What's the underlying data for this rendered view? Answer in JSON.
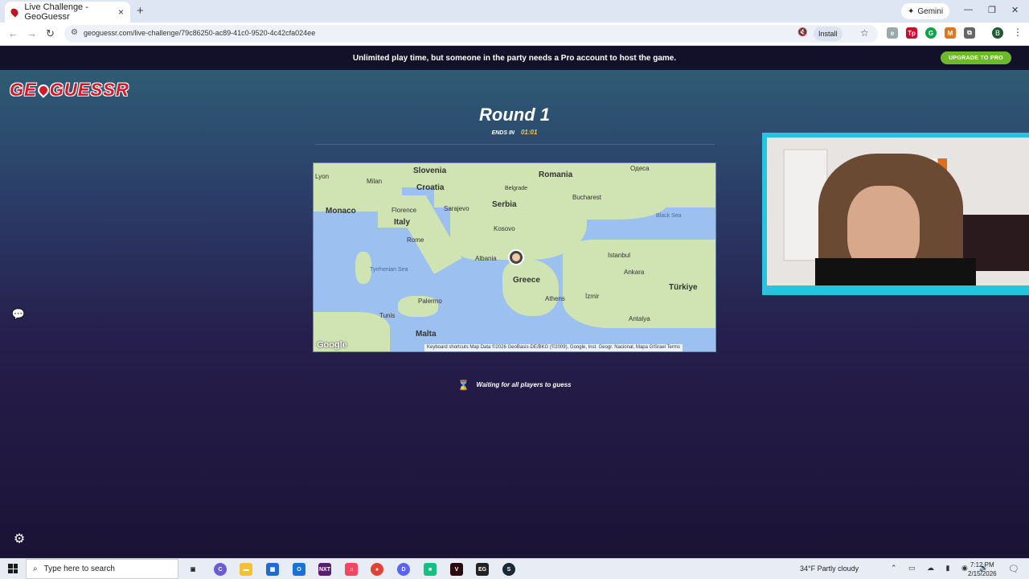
{
  "browser": {
    "tab_title": "Live Challenge - GeoGuessr",
    "tab_close": "×",
    "new_tab": "+",
    "gemini_label": "Gemini",
    "url": "geoguessr.com/live-challenge/79c86250-ac89-41c0-9520-4c42cfa024ee",
    "install_label": "Install",
    "profile_initial": "B"
  },
  "banner": {
    "text": "Unlimited play time, but someone in the party needs a Pro account to host the game.",
    "upgrade_label": "UPGRADE TO PRO"
  },
  "game": {
    "logo_pre": "GE",
    "logo_post": "GUESSR",
    "round_title": "Round 1",
    "ends_label": "ENDS IN",
    "timer": "01:01",
    "waiting_text": "Waiting for all players to guess"
  },
  "map": {
    "labels": {
      "lyon": "Lyon",
      "milan": "Milan",
      "slovenia": "Slovenia",
      "romania": "Romania",
      "odesa": "Одеса",
      "croatia": "Croatia",
      "belgrade": "Belgrade",
      "monaco": "Monaco",
      "florence": "Florence",
      "sarajevo": "Sarajevo",
      "serbia": "Serbia",
      "bucharest": "Bucharest",
      "italy": "Italy",
      "black_sea": "Black Sea",
      "kosovo": "Kosovo",
      "rome": "Rome",
      "istanbul": "Istanbul",
      "albania": "Albania",
      "tyrrhenian": "Tyrrhenian Sea",
      "greece": "Greece",
      "ankara": "Ankara",
      "turkiye": "Türkiye",
      "palermo": "Palermo",
      "athens": "Athens",
      "izmir": "İzmir",
      "tunis": "Tunis",
      "antalya": "Antalya",
      "malta": "Malta"
    },
    "attribution": "Keyboard shortcuts   Map Data ©2026 GeoBasis-DE/BKG (©2009), Google, Inst. Geogr. Nacional, Mapa GISrael   Terms",
    "google_mark": "Google"
  },
  "taskbar": {
    "search_placeholder": "Type here to search",
    "weather": "34°F  Partly cloudy",
    "time": "7:12 PM",
    "date": "2/15/2026"
  }
}
